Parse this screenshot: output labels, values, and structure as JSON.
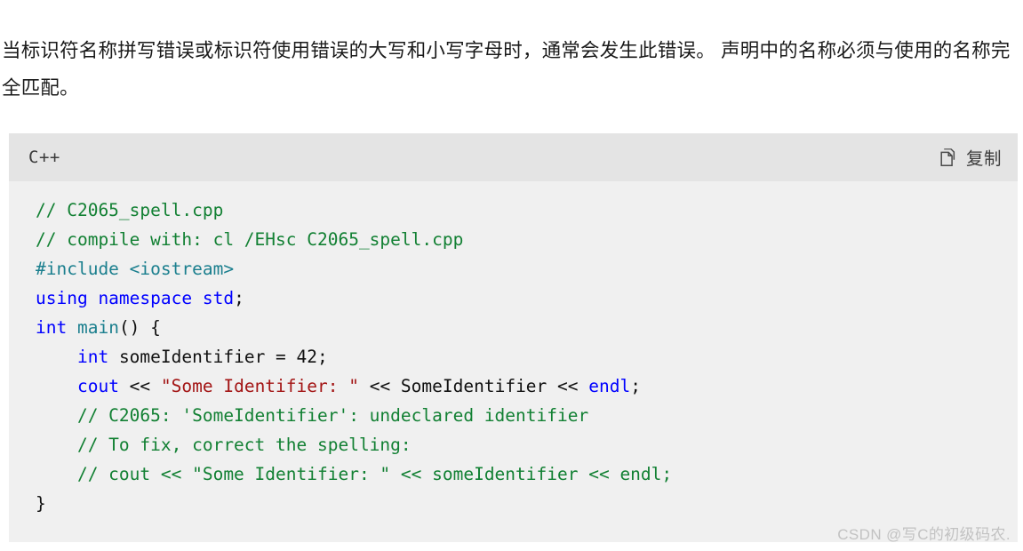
{
  "intro": {
    "paragraph": "当标识符名称拼写错误或标识符使用错误的大写和小写字母时，通常会发生此错误。 声明中的名称必须与使用的名称完全匹配。"
  },
  "code_block": {
    "language_label": "C++",
    "copy_button_label": "复制",
    "copy_icon": "copy-pages-icon",
    "header_bg": "#e4e4e4",
    "body_bg": "#f0f0f0",
    "colors": {
      "comment": "#128033",
      "preprocessor": "#1b7f8e",
      "keyword": "#0000ff",
      "function": "#1b7f8e",
      "string": "#a31515",
      "plain": "#111111"
    },
    "lines": [
      [
        {
          "t": "// C2065_spell.cpp",
          "c": "t-com"
        }
      ],
      [
        {
          "t": "// compile with: cl /EHsc C2065_spell.cpp",
          "c": "t-com"
        }
      ],
      [
        {
          "t": "#include <iostream>",
          "c": "t-pre"
        }
      ],
      [
        {
          "t": "using namespace std",
          "c": "t-kw"
        },
        {
          "t": ";",
          "c": "t-pln"
        }
      ],
      [
        {
          "t": "int ",
          "c": "t-kw"
        },
        {
          "t": "main",
          "c": "t-fn"
        },
        {
          "t": "() {",
          "c": "t-pln"
        }
      ],
      [
        {
          "t": "    ",
          "c": "t-pln"
        },
        {
          "t": "int",
          "c": "t-kw"
        },
        {
          "t": " someIdentifier = 42;",
          "c": "t-pln"
        }
      ],
      [
        {
          "t": "    ",
          "c": "t-pln"
        },
        {
          "t": "cout",
          "c": "t-kw"
        },
        {
          "t": " << ",
          "c": "t-pln"
        },
        {
          "t": "\"Some Identifier: \"",
          "c": "t-str"
        },
        {
          "t": " << SomeIdentifier << ",
          "c": "t-pln"
        },
        {
          "t": "endl",
          "c": "t-kw"
        },
        {
          "t": ";",
          "c": "t-pln"
        }
      ],
      [
        {
          "t": "    // C2065: 'SomeIdentifier': undeclared identifier",
          "c": "t-com"
        }
      ],
      [
        {
          "t": "    // To fix, correct the spelling:",
          "c": "t-com"
        }
      ],
      [
        {
          "t": "    // cout << \"Some Identifier: \" << someIdentifier << endl;",
          "c": "t-com"
        }
      ],
      [
        {
          "t": "}",
          "c": "t-pln"
        }
      ]
    ]
  },
  "watermark": {
    "text": "CSDN @写C的初级码农."
  }
}
